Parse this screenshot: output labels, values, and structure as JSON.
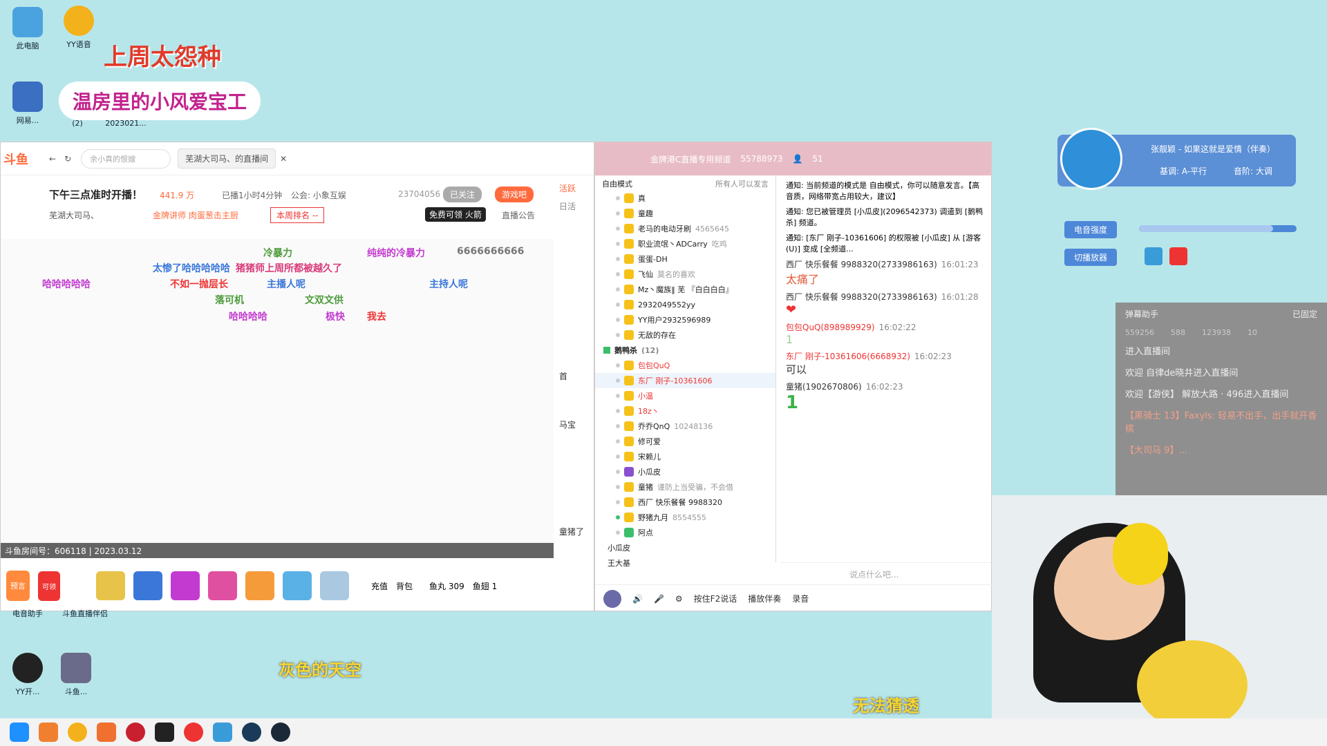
{
  "desktop": {
    "icons": [
      {
        "label": "此电脑"
      },
      {
        "label": "YY语音"
      },
      {
        "label": "网易..."
      },
      {
        "label": "(2)"
      },
      {
        "label": "2023021..."
      },
      {
        "label": "电音助手"
      },
      {
        "label": "斗鱼直播伴侣"
      },
      {
        "label": "YY开..."
      },
      {
        "label": "斗鱼..."
      }
    ],
    "art_text_1": "上周太怨种",
    "art_text_2": "温房里的小风爱宝工",
    "lyric_1": "灰色的天空",
    "lyric_2": "无法猜透"
  },
  "browser": {
    "search_placeholder": "余小真的恨嫂",
    "tab_label": "芜湖大司马、的直播间",
    "stream_title": "下午三点准时开播！",
    "heat": "441.9 万",
    "live_time": "已播1小时4分钟",
    "guild": "公会: 小象互娱",
    "room_num": "23704056",
    "follow_label": "已关注",
    "game_label": "游戏吧",
    "host_name": "芜湖大司马、",
    "tag_1": "金牌讲师 肉蛋葱击主厨",
    "rank_label": "本周排名 --",
    "free_label": "免费可领",
    "fire_label": "火箭",
    "notice_label": "直播公告",
    "room_footer": "斗鱼房间号：606118 | 2023.03.12",
    "danmu": [
      "冷暴力",
      "纯纯的冷暴力",
      "6666666666",
      "太惨了哈哈哈哈哈",
      "猪猪师上周所都被越久了",
      "哈哈哈哈哈",
      "不如一抛层长",
      "主播人呢",
      "主持人呢",
      "文双文供",
      "落可机",
      "哈哈哈哈",
      "极快",
      "我去"
    ],
    "toolbar": {
      "recharge": "充值",
      "bag": "背包",
      "fish_ball_label": "鱼丸",
      "fish_ball": "309",
      "fish_fin_label": "鱼翅",
      "fish_fin": "1",
      "predict": "预言",
      "get": "可领"
    },
    "side_labels": [
      "活跃",
      "日活",
      "首",
      "马宝",
      "童猪了"
    ]
  },
  "voice": {
    "channel": "金牌港C直播专用频道",
    "channel_id": "55788973",
    "online": "51",
    "mode_label": "自由模式",
    "mode_desc": "所有人可以发言",
    "members": [
      {
        "name": "真"
      },
      {
        "name": "童趣"
      },
      {
        "name": "老马的电动牙刷",
        "extra": "4565645"
      },
      {
        "name": "职业流氓丶ADCarry",
        "extra": "吃鸡"
      },
      {
        "name": "蛋蛋-DH"
      },
      {
        "name": "飞仙",
        "extra": "莫名的喜欢"
      },
      {
        "name": "Mz丶魔族‖ 芜 『白白白白』"
      },
      {
        "name": "2932049552yy"
      },
      {
        "name": "YY用户2932596989"
      },
      {
        "name": "无敌的存在"
      }
    ],
    "group_name": "鹅鸭杀",
    "group_count": "(12)",
    "group_members": [
      {
        "name": "包包QuQ"
      },
      {
        "name": "东厂 刚子-10361606"
      },
      {
        "name": "小温"
      },
      {
        "name": "18z丶"
      },
      {
        "name": "乔乔QnQ",
        "extra": "10248136"
      },
      {
        "name": "修可爱"
      },
      {
        "name": "宋赖儿"
      },
      {
        "name": "小瓜皮"
      },
      {
        "name": "童猪",
        "extra": "谨防上当受骗，不会借"
      },
      {
        "name": "西厂 快乐餐餐 9988320"
      },
      {
        "name": "野猪九月",
        "extra": "8554555"
      },
      {
        "name": "阿点"
      }
    ],
    "tail_members": [
      {
        "name": "小瓜皮"
      },
      {
        "name": "王大基"
      }
    ],
    "notices": [
      "通知: 当前频道的模式是 自由模式，你可以随意发言。【高音质，网络带宽占用较大，建议】",
      "通知: 您已被管理员 [小瓜皮](2096542373) 调遣到 [鹅鸭杀] 频道。",
      "通知: [东厂 刚子-10361606] 的权限被 [小瓜皮] 从 [游客(U)] 变成 [全频道..."
    ],
    "messages": [
      {
        "who": "西厂 快乐餐餐 9988320(2733986163)",
        "time": "16:01:23",
        "text": "太痛了"
      },
      {
        "who": "西厂 快乐餐餐 9988320(2733986163)",
        "time": "16:01:28",
        "text": "❤"
      },
      {
        "who": "包包QuQ(898989929)",
        "time": "16:02:22",
        "text": "1"
      },
      {
        "who": "东厂 刚子-10361606(6668932)",
        "time": "16:02:23",
        "text": "可以"
      },
      {
        "who": "童猪(1902670806)",
        "time": "16:02:23",
        "text": "1"
      }
    ],
    "input_placeholder": "说点什么吧...",
    "bottom": {
      "ptt": "按住F2说话",
      "accomp": "播放伴奏",
      "record": "录音"
    }
  },
  "music": {
    "song": "张靓颖 - 如果这就是爱情（伴奏）",
    "key": "基调: A-平行",
    "pitch": "音阶: 大调",
    "electro_label": "电音强度",
    "switch_label": "切播放器",
    "strength_fraction": 0.85
  },
  "danmu_helper": {
    "title": "弹幕助手",
    "pinned": "已固定",
    "stats": [
      "559256",
      "588",
      "123938",
      "10"
    ],
    "lines": [
      "进入直播间",
      "欢迎 自律de晓井进入直播间",
      "欢迎【游侠】 解放大路 · 496进入直播间",
      "【黑骑士 13】Faxyls: 轻易不出手，出手就开香槟",
      "【大司马 9】..."
    ]
  },
  "colors": {
    "accent": "#ff6a3d",
    "voice_head": "#e8bcc6",
    "music_bg": "#5b8fd6"
  }
}
